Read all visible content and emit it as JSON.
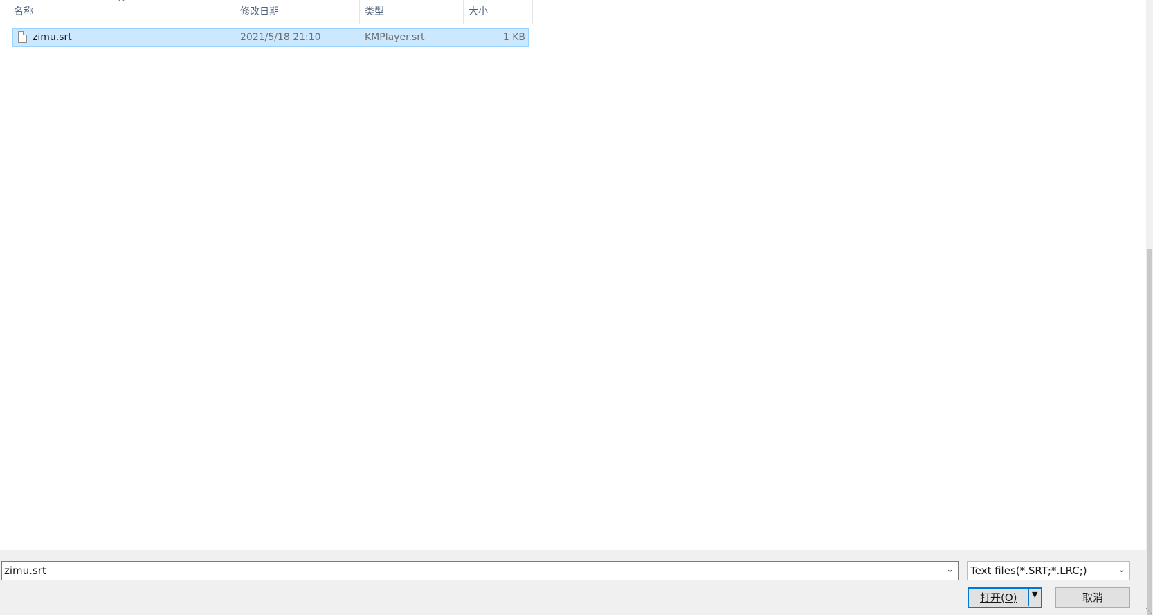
{
  "columns": {
    "name": "名称",
    "modified": "修改日期",
    "type": "类型",
    "size": "大小"
  },
  "sort_indicator": "^",
  "files": [
    {
      "name": "zimu.srt",
      "modified": "2021/5/18 21:10",
      "type": "KMPlayer.srt",
      "size": "1 KB",
      "selected": true
    }
  ],
  "bottom": {
    "filename_value": "zimu.srt",
    "filetype_value": "Text files(*.SRT;*.LRC;)",
    "open_label": "打开(O)",
    "cancel_label": "取消"
  },
  "colors": {
    "selection": "#cce8ff",
    "selection_border": "#99d1ff",
    "accent": "#0078d7",
    "panel": "#f0f0f0"
  },
  "icons": [
    "sort-ascending-icon",
    "file-icon",
    "chevron-down-icon",
    "split-arrow-icon",
    "resize-grip-icon"
  ]
}
